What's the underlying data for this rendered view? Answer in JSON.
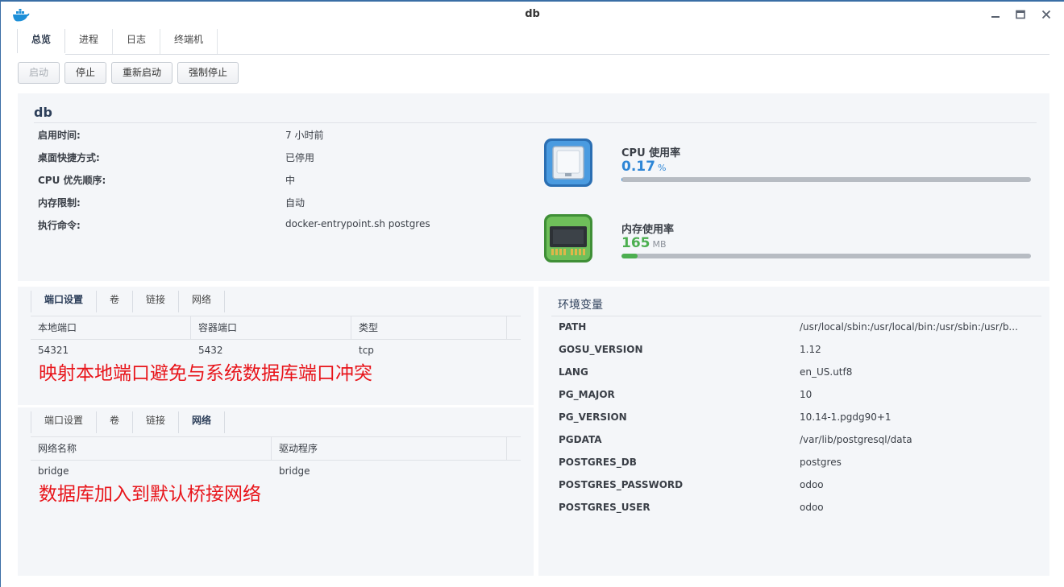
{
  "window": {
    "title": "db",
    "app_icon": "docker-whale-icon"
  },
  "main_tabs": [
    {
      "label": "总览",
      "active": true
    },
    {
      "label": "进程",
      "active": false
    },
    {
      "label": "日志",
      "active": false
    },
    {
      "label": "终端机",
      "active": false
    }
  ],
  "toolbar": {
    "start_label": "启动",
    "stop_label": "停止",
    "restart_label": "重新启动",
    "force_stop_label": "强制停止"
  },
  "overview": {
    "name": "db",
    "info": [
      {
        "label": "启用时间:",
        "value": "7 小时前"
      },
      {
        "label": "桌面快捷方式:",
        "value": "已停用"
      },
      {
        "label": "CPU 优先顺序:",
        "value": "中"
      },
      {
        "label": "内存限制:",
        "value": "自动"
      },
      {
        "label": "执行命令:",
        "value": "docker-entrypoint.sh postgres"
      }
    ],
    "cpu": {
      "label": "CPU 使用率",
      "value": "0.17",
      "unit": "%",
      "fraction": 0.0017,
      "color": "#2e86d6"
    },
    "memory": {
      "label": "内存使用率",
      "value": "165",
      "unit": "MB",
      "fraction": 0.04,
      "color": "#4caf50"
    }
  },
  "ports_panel": {
    "tabs": [
      "端口设置",
      "卷",
      "链接",
      "网络"
    ],
    "active_tab": "端口设置",
    "columns": [
      "本地端口",
      "容器端口",
      "类型"
    ],
    "rows": [
      [
        "54321",
        "5432",
        "tcp"
      ]
    ],
    "annotation": "映射本地端口避免与系统数据库端口冲突"
  },
  "network_panel": {
    "tabs": [
      "端口设置",
      "卷",
      "链接",
      "网络"
    ],
    "active_tab": "网络",
    "columns": [
      "网络名称",
      "驱动程序"
    ],
    "rows": [
      [
        "bridge",
        "bridge"
      ]
    ],
    "annotation": "数据库加入到默认桥接网络"
  },
  "env_panel": {
    "title": "环境变量",
    "vars": [
      {
        "key": "PATH",
        "value": "/usr/local/sbin:/usr/local/bin:/usr/sbin:/usr/b..."
      },
      {
        "key": "GOSU_VERSION",
        "value": "1.12"
      },
      {
        "key": "LANG",
        "value": "en_US.utf8"
      },
      {
        "key": "PG_MAJOR",
        "value": "10"
      },
      {
        "key": "PG_VERSION",
        "value": "10.14-1.pgdg90+1"
      },
      {
        "key": "PGDATA",
        "value": "/var/lib/postgresql/data"
      },
      {
        "key": "POSTGRES_DB",
        "value": "postgres"
      },
      {
        "key": "POSTGRES_PASSWORD",
        "value": "odoo"
      },
      {
        "key": "POSTGRES_USER",
        "value": "odoo"
      }
    ]
  }
}
